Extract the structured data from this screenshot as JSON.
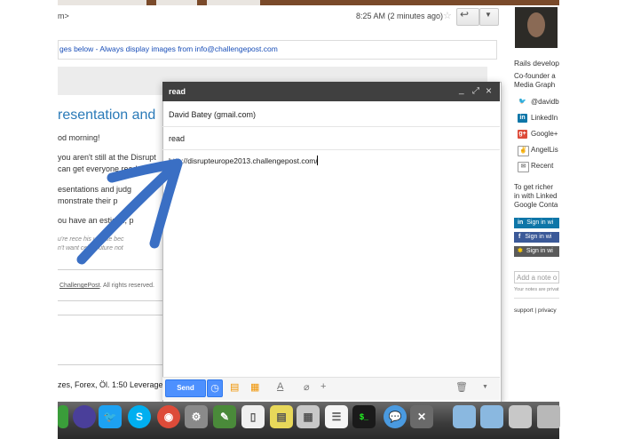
{
  "email": {
    "sender_fragment": "m>",
    "time": "8:25 AM (2 minutes ago)",
    "images_notice": "ges below - Always display images from info@challengepost.com",
    "heading": "resentation and",
    "lines": [
      "od morning!",
      "you aren't still at the Disrupt",
      "can get everyone ready",
      "esentations and judg",
      "monstrate their p",
      "ou have an     estions, p"
    ],
    "fine_print": [
      "u're rece       his update bec",
      "n't want        ceive future not"
    ],
    "footer_link": "ChallengePost",
    "footer_text": ". All rights reserved.",
    "bottom_text": "zes, Forex, Öl. 1:50 Leverage!"
  },
  "compose": {
    "title": "read",
    "to": "David Batey (gmail.com)",
    "subject": "read",
    "body": "http://disrupteurope2013.challengepost.com/",
    "send_label": "Send",
    "minimize_icon": "_",
    "popout_icon": "⤢",
    "close_icon": "×"
  },
  "sidebar": {
    "title": "Rails develop",
    "subtitle_lines": [
      "Co-founder a",
      "Media Graph"
    ],
    "links": [
      {
        "label": "@davidb",
        "icon": "twitter-icon"
      },
      {
        "label": "LinkedIn",
        "icon": "linkedin-icon"
      },
      {
        "label": "Google+",
        "icon": "google-plus-icon"
      },
      {
        "label": "AngelLis",
        "icon": "angellist-icon"
      },
      {
        "label": "Recent",
        "icon": "mail-icon"
      }
    ],
    "richer_lines": [
      "To get richer",
      "in with Linked",
      "Google Conta"
    ],
    "signin_buttons": [
      "Sign in wi",
      "Sign in wi",
      "Sign in wi"
    ],
    "note_placeholder": "Add a note o",
    "note_hint": "Your notes are privat",
    "support": "support",
    "privacy": "privacy"
  },
  "colors": {
    "link_blue": "#1a4fb8",
    "heading_blue": "#2a7ab8",
    "send_blue": "#4d90fe",
    "arrow_blue": "#3a6fc4"
  }
}
